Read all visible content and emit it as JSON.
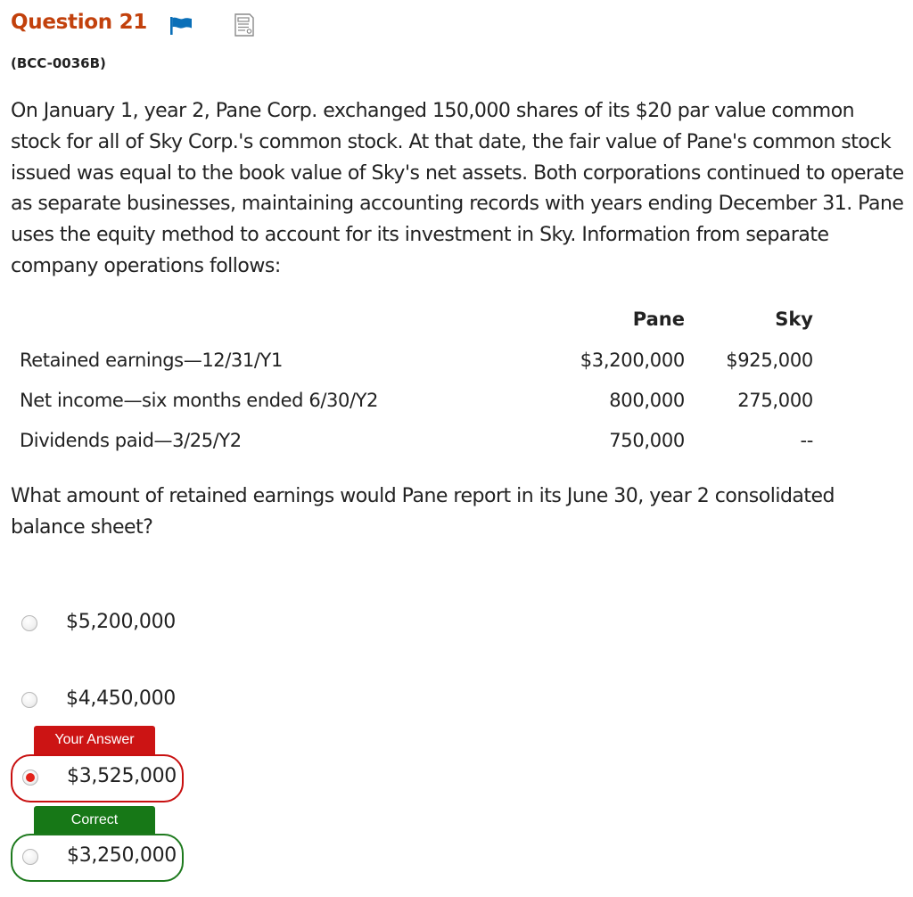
{
  "header": {
    "question_title": "Question 21",
    "question_code": "(BCC-0036B)",
    "flag_color": "#0a6fb8",
    "title_color": "#c2410c"
  },
  "stem": "On January 1, year 2, Pane Corp. exchanged 150,000 shares of its $20 par value common stock for all of Sky Corp.'s common stock. At that date, the fair value of Pane's common stock issued was equal to the book value of Sky's net assets. Both corporations continued to operate as separate businesses, maintaining accounting records with years ending December 31. Pane uses the equity method to account for its investment in Sky. Information from separate company operations follows:",
  "table": {
    "headers": [
      "Pane",
      "Sky"
    ],
    "rows": [
      {
        "label": "Retained earnings—12/31/Y1",
        "pane": "$3,200,000",
        "sky": "$925,000"
      },
      {
        "label": "Net income—six months ended 6/30/Y2",
        "pane": "800,000",
        "sky": "275,000"
      },
      {
        "label": "Dividends paid—3/25/Y2",
        "pane": "750,000",
        "sky": "--"
      }
    ]
  },
  "prompt": "What amount of retained earnings would Pane report in its June 30, year 2 consolidated balance sheet?",
  "options": [
    {
      "text": "$5,200,000",
      "selected": false
    },
    {
      "text": "$4,450,000",
      "selected": false
    },
    {
      "text": "$3,525,000",
      "selected": true,
      "tag": "Your Answer"
    },
    {
      "text": "$3,250,000",
      "selected": false,
      "tag": "Correct"
    }
  ],
  "colors": {
    "wrong": "#cc1414",
    "correct": "#177817",
    "radio_selected": "#e3241b"
  }
}
